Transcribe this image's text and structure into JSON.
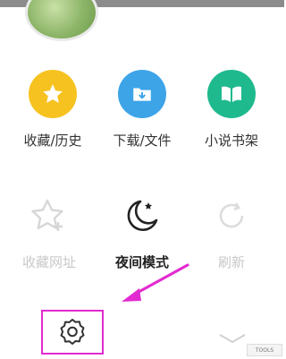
{
  "menu": {
    "row1": [
      {
        "label": "收藏/历史",
        "icon": "star-icon",
        "color": "#f6c220"
      },
      {
        "label": "下载/文件",
        "icon": "download-folder-icon",
        "color": "#3da4e8"
      },
      {
        "label": "小说书架",
        "icon": "book-icon",
        "color": "#1fb98e"
      }
    ],
    "row2": [
      {
        "label": "收藏网址",
        "icon": "star-plus-icon",
        "state": "disabled"
      },
      {
        "label": "夜间模式",
        "icon": "moon-icon",
        "state": "active"
      },
      {
        "label": "刷新",
        "icon": "refresh-icon",
        "state": "disabled"
      }
    ]
  },
  "highlight_color": "#e22ad0",
  "watermark": "TOOLS"
}
